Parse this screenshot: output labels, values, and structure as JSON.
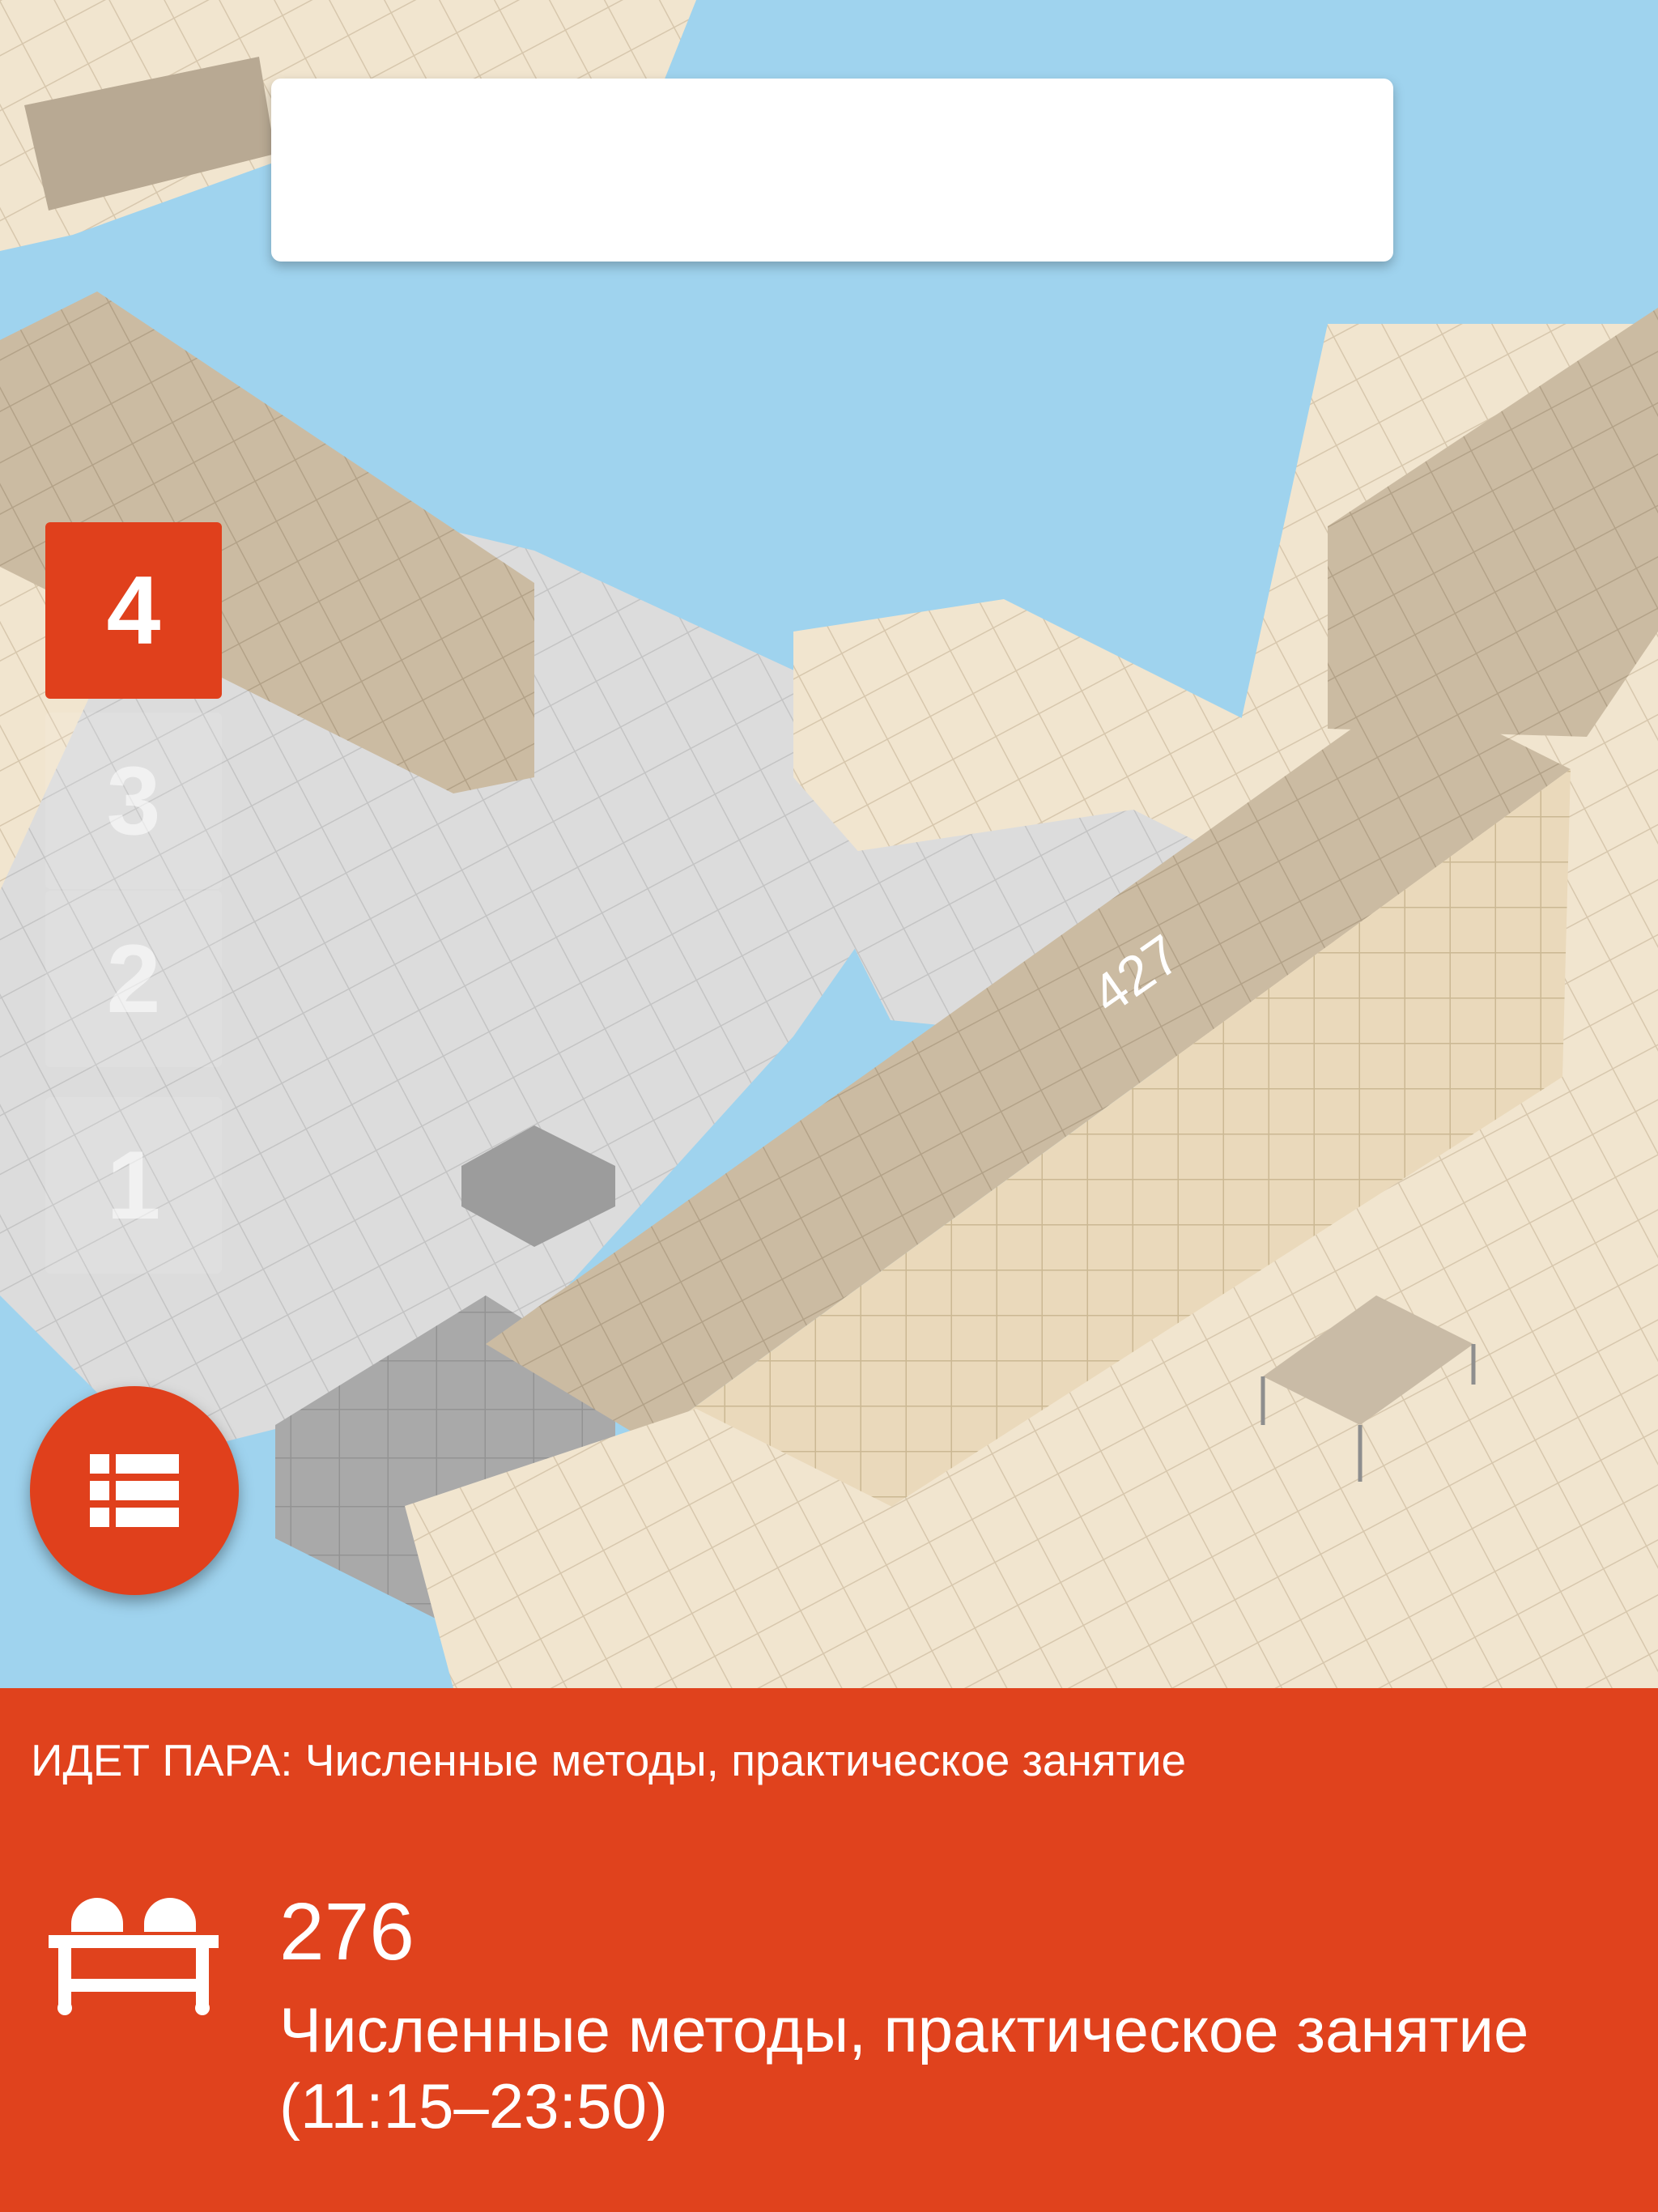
{
  "map": {
    "room_label": "427"
  },
  "search": {
    "value": ""
  },
  "floor_selector": {
    "floors": [
      "4",
      "3",
      "2",
      "1"
    ],
    "active_floor": "4"
  },
  "list_button": {
    "icon": "list-icon"
  },
  "current_lesson": {
    "now_text": "ИДЕТ ПАРА: Численные методы, практическое занятие",
    "room_number": "276",
    "description": "Численные методы, практическое занятие (11:15–23:50)",
    "icon": "desk-icon"
  },
  "colors": {
    "accent": "#e0421d",
    "sky": "#9fd3ee",
    "wall": "#c9b9a0",
    "floor_light": "#f2e6d0",
    "floor_gray": "#d8d8d8"
  }
}
